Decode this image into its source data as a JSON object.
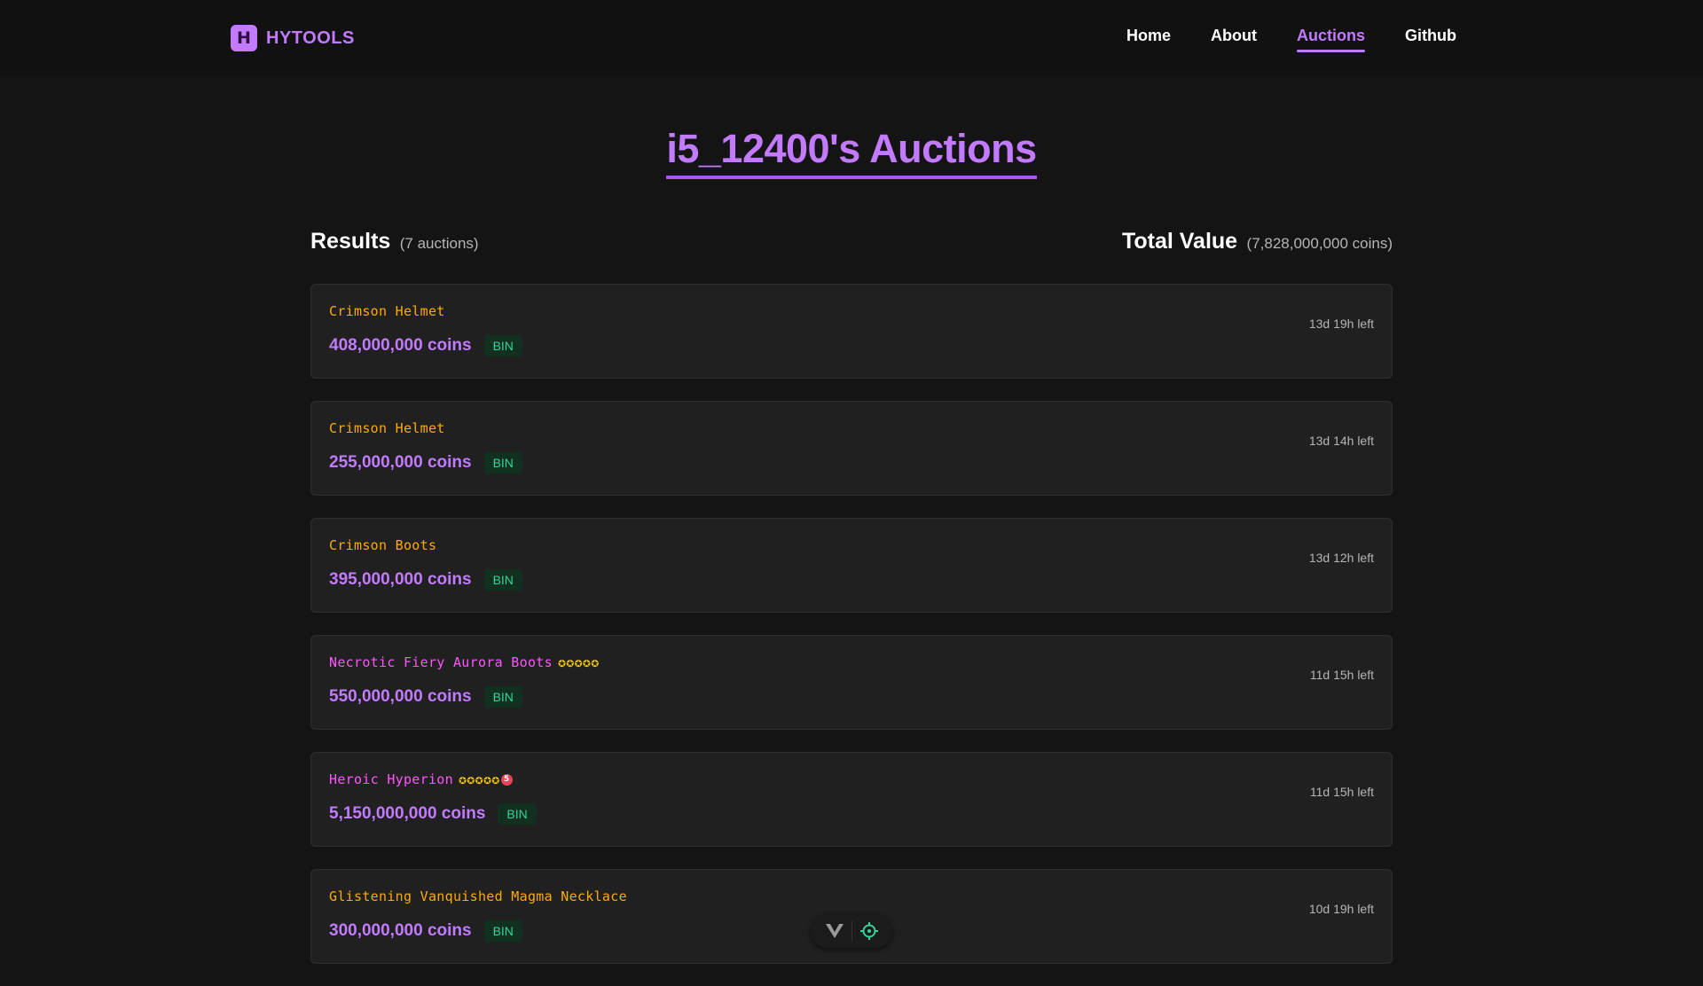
{
  "brand": {
    "logo_letter": "H",
    "name": "HYTOOLS",
    "accent": "#c27aff"
  },
  "nav": {
    "items": [
      {
        "label": "Home",
        "active": false
      },
      {
        "label": "About",
        "active": false
      },
      {
        "label": "Auctions",
        "active": true
      },
      {
        "label": "Github",
        "active": false
      }
    ]
  },
  "page": {
    "title": "i5_12400's Auctions"
  },
  "summary": {
    "results_label": "Results",
    "results_count": "(7 auctions)",
    "total_label": "Total Value",
    "total_value": "(7,828,000,000 coins)"
  },
  "auctions": [
    {
      "name": "Crimson Helmet",
      "name_color": "#ffaa00",
      "stars": "",
      "master_star": "",
      "price": "408,000,000 coins",
      "badge": "BIN",
      "time_left": "13d 19h left"
    },
    {
      "name": "Crimson Helmet",
      "name_color": "#ffaa00",
      "stars": "",
      "master_star": "",
      "price": "255,000,000 coins",
      "badge": "BIN",
      "time_left": "13d 14h left"
    },
    {
      "name": "Crimson Boots",
      "name_color": "#ffaa00",
      "stars": "",
      "master_star": "",
      "price": "395,000,000 coins",
      "badge": "BIN",
      "time_left": "13d 12h left"
    },
    {
      "name": "Necrotic Fiery Aurora Boots",
      "name_color": "#ff55ff",
      "stars": "✪✪✪✪✪",
      "master_star": "",
      "price": "550,000,000 coins",
      "badge": "BIN",
      "time_left": "11d 15h left"
    },
    {
      "name": "Heroic Hyperion",
      "name_color": "#ff55ff",
      "stars": "✪✪✪✪✪",
      "master_star": "5",
      "price": "5,150,000,000 coins",
      "badge": "BIN",
      "time_left": "11d 15h left"
    },
    {
      "name": "Glistening Vanquished Magma Necklace",
      "name_color": "#ffaa00",
      "stars": "",
      "master_star": "",
      "price": "300,000,000 coins",
      "badge": "BIN",
      "time_left": "10d 19h left"
    }
  ],
  "toolbar": {
    "left_icon": "vue-logo-icon",
    "right_icon": "crosshair-icon"
  },
  "colors": {
    "background": "#141414",
    "card": "#202020",
    "accent": "#c27aff",
    "bin_badge_text": "#34d399",
    "legendary": "#ffaa00",
    "mythic": "#ff55ff",
    "star": "#f5c518"
  }
}
